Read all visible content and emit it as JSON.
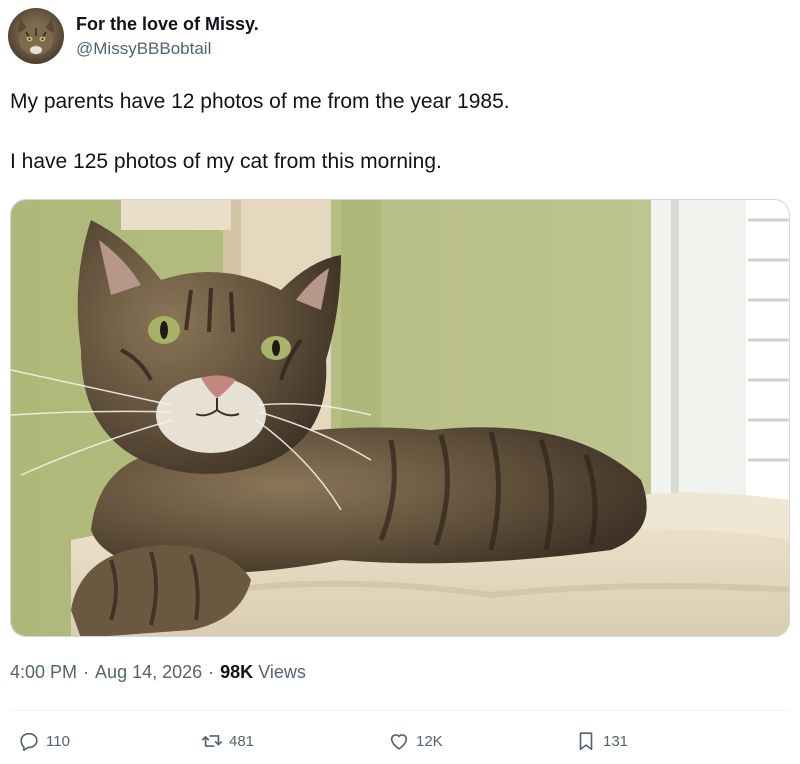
{
  "author": {
    "display_name": "For the love of Missy.",
    "handle": "@MissyBBBobtail"
  },
  "tweet": {
    "paragraphs": [
      "My parents have 12 photos of me from the year 1985.",
      "I have 125 photos of my cat from this morning."
    ],
    "media_icon": "photo-of-tabby-cat-on-cat-tree"
  },
  "meta": {
    "time": "4:00 PM",
    "separator": "·",
    "date": "Aug 14, 2026",
    "views_count": "98K",
    "views_label": "Views"
  },
  "actions": {
    "reply_count": "110",
    "retweet_count": "481",
    "like_count": "12K",
    "bookmark_count": "131"
  },
  "colors": {
    "text_primary": "#0f1419",
    "text_secondary": "#536471",
    "divider": "#eff3f4"
  }
}
